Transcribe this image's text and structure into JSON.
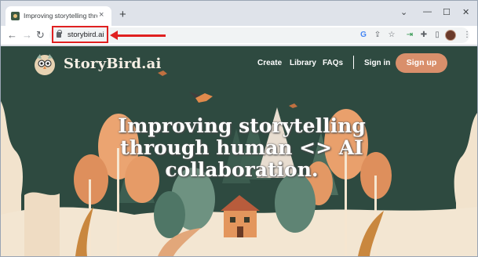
{
  "browser": {
    "tab": {
      "title": "Improving storytelling through h",
      "close": "×"
    },
    "new_tab": "+",
    "window_controls": {
      "minimize": "⌄",
      "restore": "—",
      "maximize": "☐",
      "close": "✕"
    },
    "nav": {
      "back": "←",
      "forward": "→",
      "reload": "↻"
    },
    "address": {
      "url": "storybird.ai"
    },
    "toolbar_icons": [
      "google-icon",
      "share-icon",
      "bookmark-star-icon",
      "extension-arrow-icon",
      "puzzle-icon",
      "side-panel-icon"
    ]
  },
  "annotation": {
    "color": "#e02020"
  },
  "site": {
    "brand": "StoryBird.ai",
    "nav": {
      "create": "Create",
      "library": "Library",
      "faqs": "FAQs",
      "sign_in": "Sign in",
      "sign_up": "Sign up"
    },
    "hero": {
      "line1": "Improving storytelling",
      "line2": "through human <> AI",
      "line3": "collaboration."
    },
    "colors": {
      "background": "#2e4a40",
      "accent": "#d98f6b",
      "cream": "#f4e7d4",
      "tree_orange": "#e59a62"
    }
  }
}
